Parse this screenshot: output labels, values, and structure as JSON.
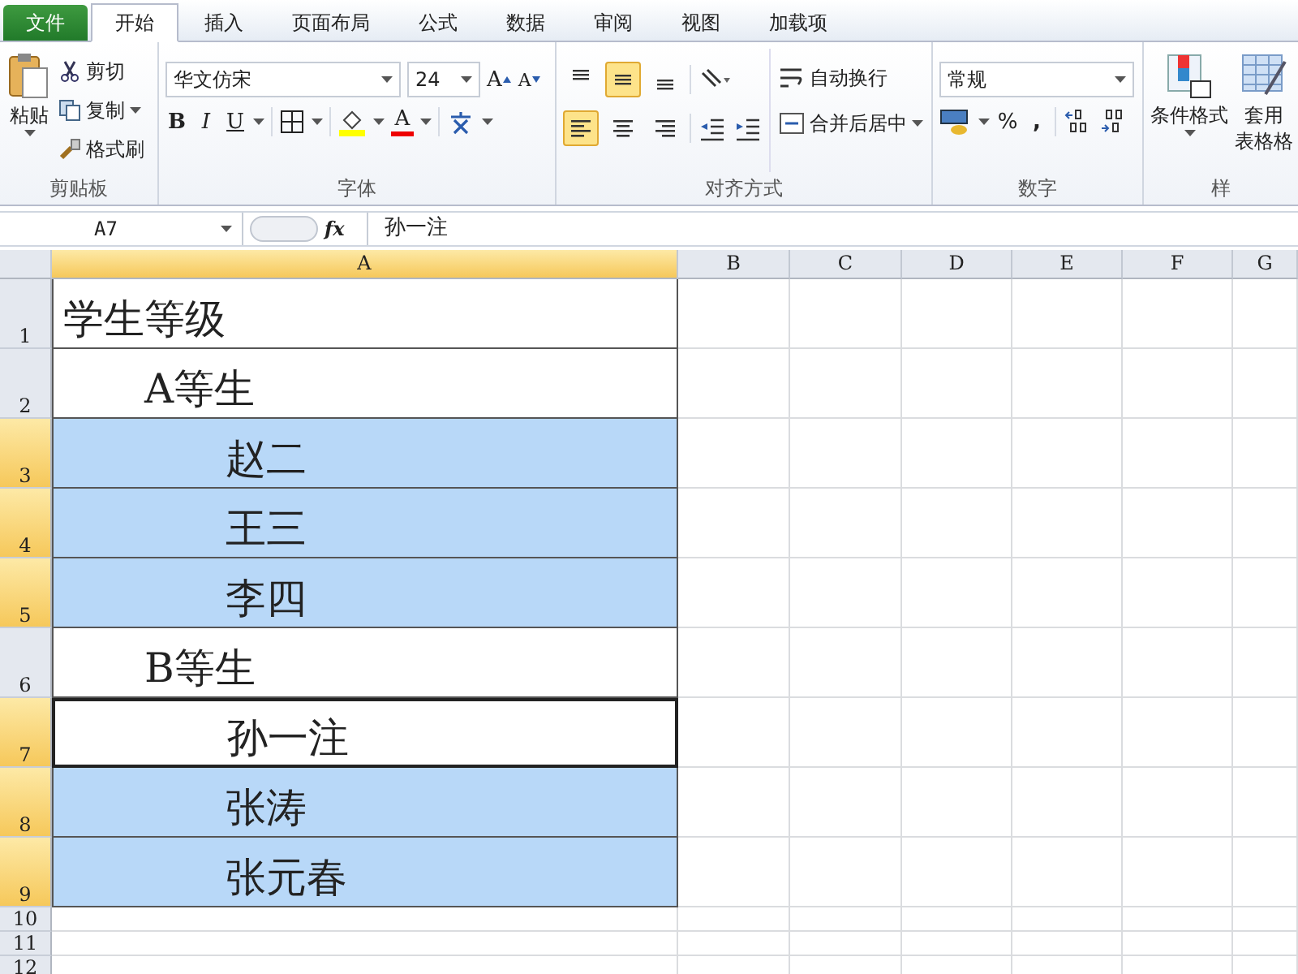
{
  "tabs": [
    {
      "label": "文件",
      "kind": "file",
      "selected": false
    },
    {
      "label": "开始",
      "kind": "tab",
      "selected": true
    },
    {
      "label": "插入",
      "kind": "tab",
      "selected": false
    },
    {
      "label": "页面布局",
      "kind": "tab",
      "selected": false
    },
    {
      "label": "公式",
      "kind": "tab",
      "selected": false
    },
    {
      "label": "数据",
      "kind": "tab",
      "selected": false
    },
    {
      "label": "审阅",
      "kind": "tab",
      "selected": false
    },
    {
      "label": "视图",
      "kind": "tab",
      "selected": false
    },
    {
      "label": "加载项",
      "kind": "tab",
      "selected": false
    }
  ],
  "ribbon": {
    "clipboard": {
      "label": "剪贴板",
      "paste": "粘贴",
      "cut": "剪切",
      "copy": "复制",
      "format_painter": "格式刷"
    },
    "font": {
      "label": "字体",
      "font_name": "华文仿宋",
      "font_size": "24",
      "grow": "A",
      "shrink": "A",
      "bold": "B",
      "italic": "I",
      "underline": "U",
      "font_color": "A"
    },
    "alignment": {
      "label": "对齐方式",
      "vertical": [
        {
          "selected": false
        },
        {
          "selected": true
        },
        {
          "selected": false
        }
      ],
      "horizontal": [
        {
          "selected": true
        },
        {
          "selected": false
        },
        {
          "selected": false
        }
      ],
      "wrap_text": "自动换行",
      "merge_center": "合并后居中"
    },
    "number": {
      "label": "数字",
      "format": "常规",
      "percent": "%",
      "comma": ","
    },
    "styles": {
      "label": "样",
      "conditional_format": "条件格式",
      "table_format_line1": "套用",
      "table_format_line2": "表格格"
    }
  },
  "formula_bar": {
    "name_box": "A7",
    "fx": "fx",
    "formula": "孙一注"
  },
  "sheet": {
    "columns": [
      {
        "label": "A",
        "selected": true
      },
      {
        "label": "B",
        "selected": false
      },
      {
        "label": "C",
        "selected": false
      },
      {
        "label": "D",
        "selected": false
      },
      {
        "label": "E",
        "selected": false
      },
      {
        "label": "F",
        "selected": false
      },
      {
        "label": "G",
        "selected": false
      }
    ],
    "title_row": {
      "row": "1",
      "text": "学生等级",
      "selected": false,
      "active": false
    },
    "groups": [
      {
        "row": "2",
        "text": "A等生",
        "selected": false,
        "active": false,
        "children": [
          {
            "row": "3",
            "text": "赵二",
            "selected": true,
            "active": false
          },
          {
            "row": "4",
            "text": "王三",
            "selected": true,
            "active": false
          },
          {
            "row": "5",
            "text": "李四",
            "selected": true,
            "active": false
          }
        ]
      },
      {
        "row": "6",
        "text": "B等生",
        "selected": false,
        "active": false,
        "children": [
          {
            "row": "7",
            "text": "孙一注",
            "selected": true,
            "active": true
          },
          {
            "row": "8",
            "text": "张涛",
            "selected": true,
            "active": false
          },
          {
            "row": "9",
            "text": "张元春",
            "selected": true,
            "active": false
          }
        ]
      }
    ],
    "empty_rows": [
      "10",
      "11",
      "12"
    ]
  }
}
